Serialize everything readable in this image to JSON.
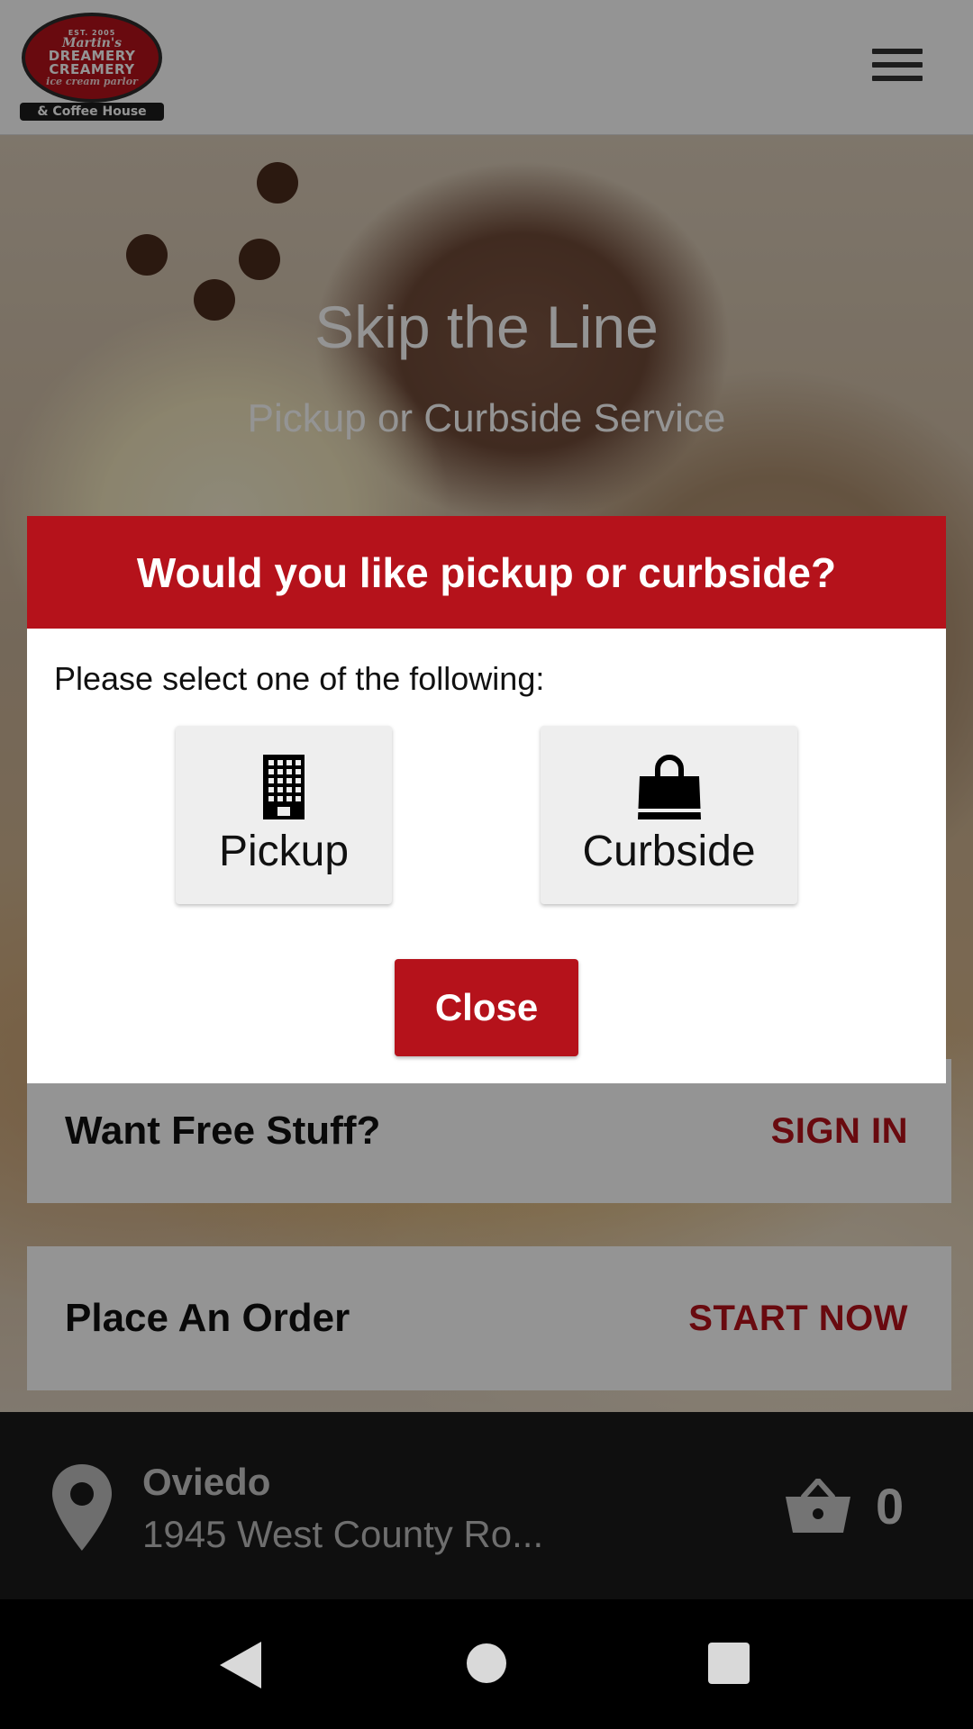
{
  "header": {
    "logo": {
      "est": "EST. 2005",
      "script": "Martin's",
      "line1": "DREAMERY",
      "line2": "CREAMERY",
      "sub": "ice cream parlor",
      "strip": "& Coffee House"
    },
    "menu_icon": "hamburger-menu-icon"
  },
  "hero": {
    "title": "Skip the Line",
    "subtitle": "Pickup or Curbside Service"
  },
  "cards": {
    "signin": {
      "title": "Want Free Stuff?",
      "action": "SIGN IN"
    },
    "order": {
      "title": "Place An Order",
      "action": "START NOW"
    }
  },
  "location": {
    "name": "Oviedo",
    "address": "1945 West County Ro...",
    "pin_icon": "map-pin-icon",
    "basket_icon": "basket-icon",
    "cart_count": "0"
  },
  "modal": {
    "title": "Would you like pickup or curbside?",
    "prompt": "Please select one of the following:",
    "options": [
      {
        "label": "Pickup",
        "icon": "building-icon"
      },
      {
        "label": "Curbside",
        "icon": "shopping-bag-icon"
      }
    ],
    "close_label": "Close"
  },
  "colors": {
    "brand_red": "#b5121b",
    "dark_bar": "#1b1b1b"
  },
  "system_nav": {
    "back": "back-icon",
    "home": "home-icon",
    "recents": "recents-icon"
  }
}
